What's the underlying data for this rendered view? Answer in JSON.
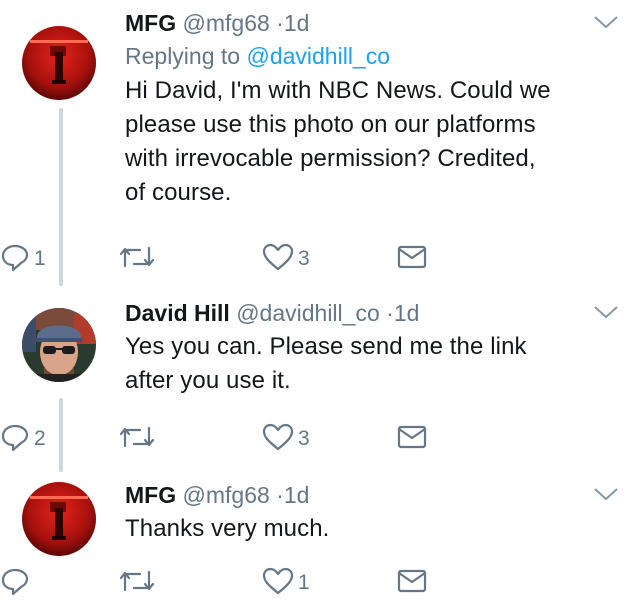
{
  "colors": {
    "link": "#1da1f2",
    "meta": "#657786",
    "icon": "#657786",
    "thread_line": "#ccd6dd"
  },
  "tweets": [
    {
      "avatar": "mfg-avatar-red-neon",
      "name": "MFG",
      "handle": "@mfg68",
      "dot": "·",
      "time": "1d",
      "replying_prefix": "Replying to",
      "replying_handle": "@davidhill_co",
      "body_lines": [
        "Hi David, I'm with NBC News. Could we",
        "please use this photo on our platforms",
        "with irrevocable permission? Credited,",
        "of course."
      ],
      "replies": "1",
      "likes": "3"
    },
    {
      "avatar": "david-hill-avatar",
      "name": "David Hill",
      "handle": "@davidhill_co",
      "dot": "·",
      "time": "1d",
      "body_lines": [
        "Yes you can.  Please send me the link",
        "after you use it."
      ],
      "replies": "2",
      "likes": "3"
    },
    {
      "avatar": "mfg-avatar-red-neon",
      "name": "MFG",
      "handle": "@mfg68",
      "dot": "·",
      "time": "1d",
      "body_lines": [
        "Thanks very much."
      ],
      "replies": "",
      "likes": "1"
    }
  ],
  "icons": {
    "reply": "reply-icon",
    "retweet": "retweet-icon",
    "like": "heart-icon",
    "message": "envelope-icon",
    "more": "chevron-down-icon"
  }
}
